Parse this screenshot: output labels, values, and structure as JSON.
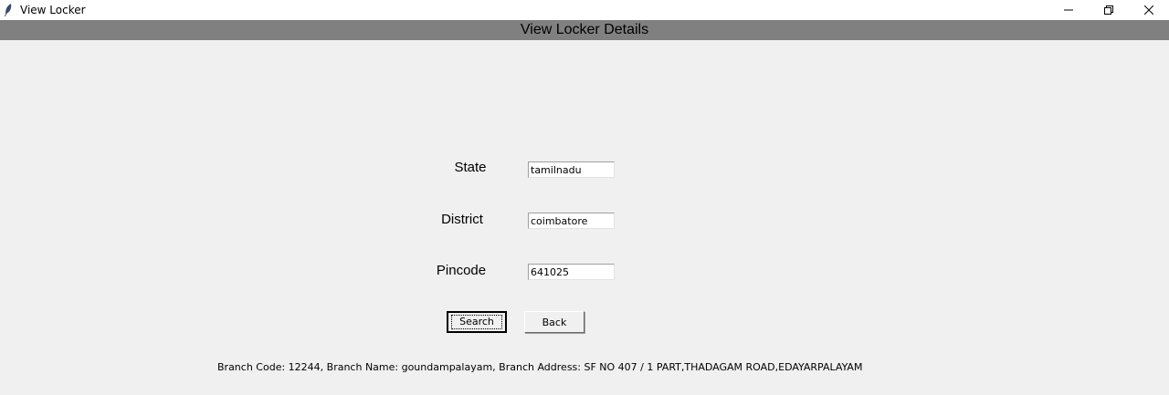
{
  "window": {
    "title": "View Locker",
    "icons": {
      "app": "feather-icon",
      "minimize": "minimize-icon",
      "maximize": "restore-icon",
      "close": "close-icon"
    }
  },
  "header": {
    "title": "View Locker Details"
  },
  "form": {
    "state": {
      "label": "State",
      "value": "tamilnadu"
    },
    "district": {
      "label": "District",
      "value": "coimbatore"
    },
    "pincode": {
      "label": "Pincode",
      "value": "641025"
    }
  },
  "buttons": {
    "search_label": "Search",
    "back_label": "Back"
  },
  "result": {
    "branch_info": "Branch Code: 12244, Branch Name: goundampalayam, Branch Address: SF NO 407 / 1 PART,THADAGAM ROAD,EDAYARPALAYAM"
  }
}
